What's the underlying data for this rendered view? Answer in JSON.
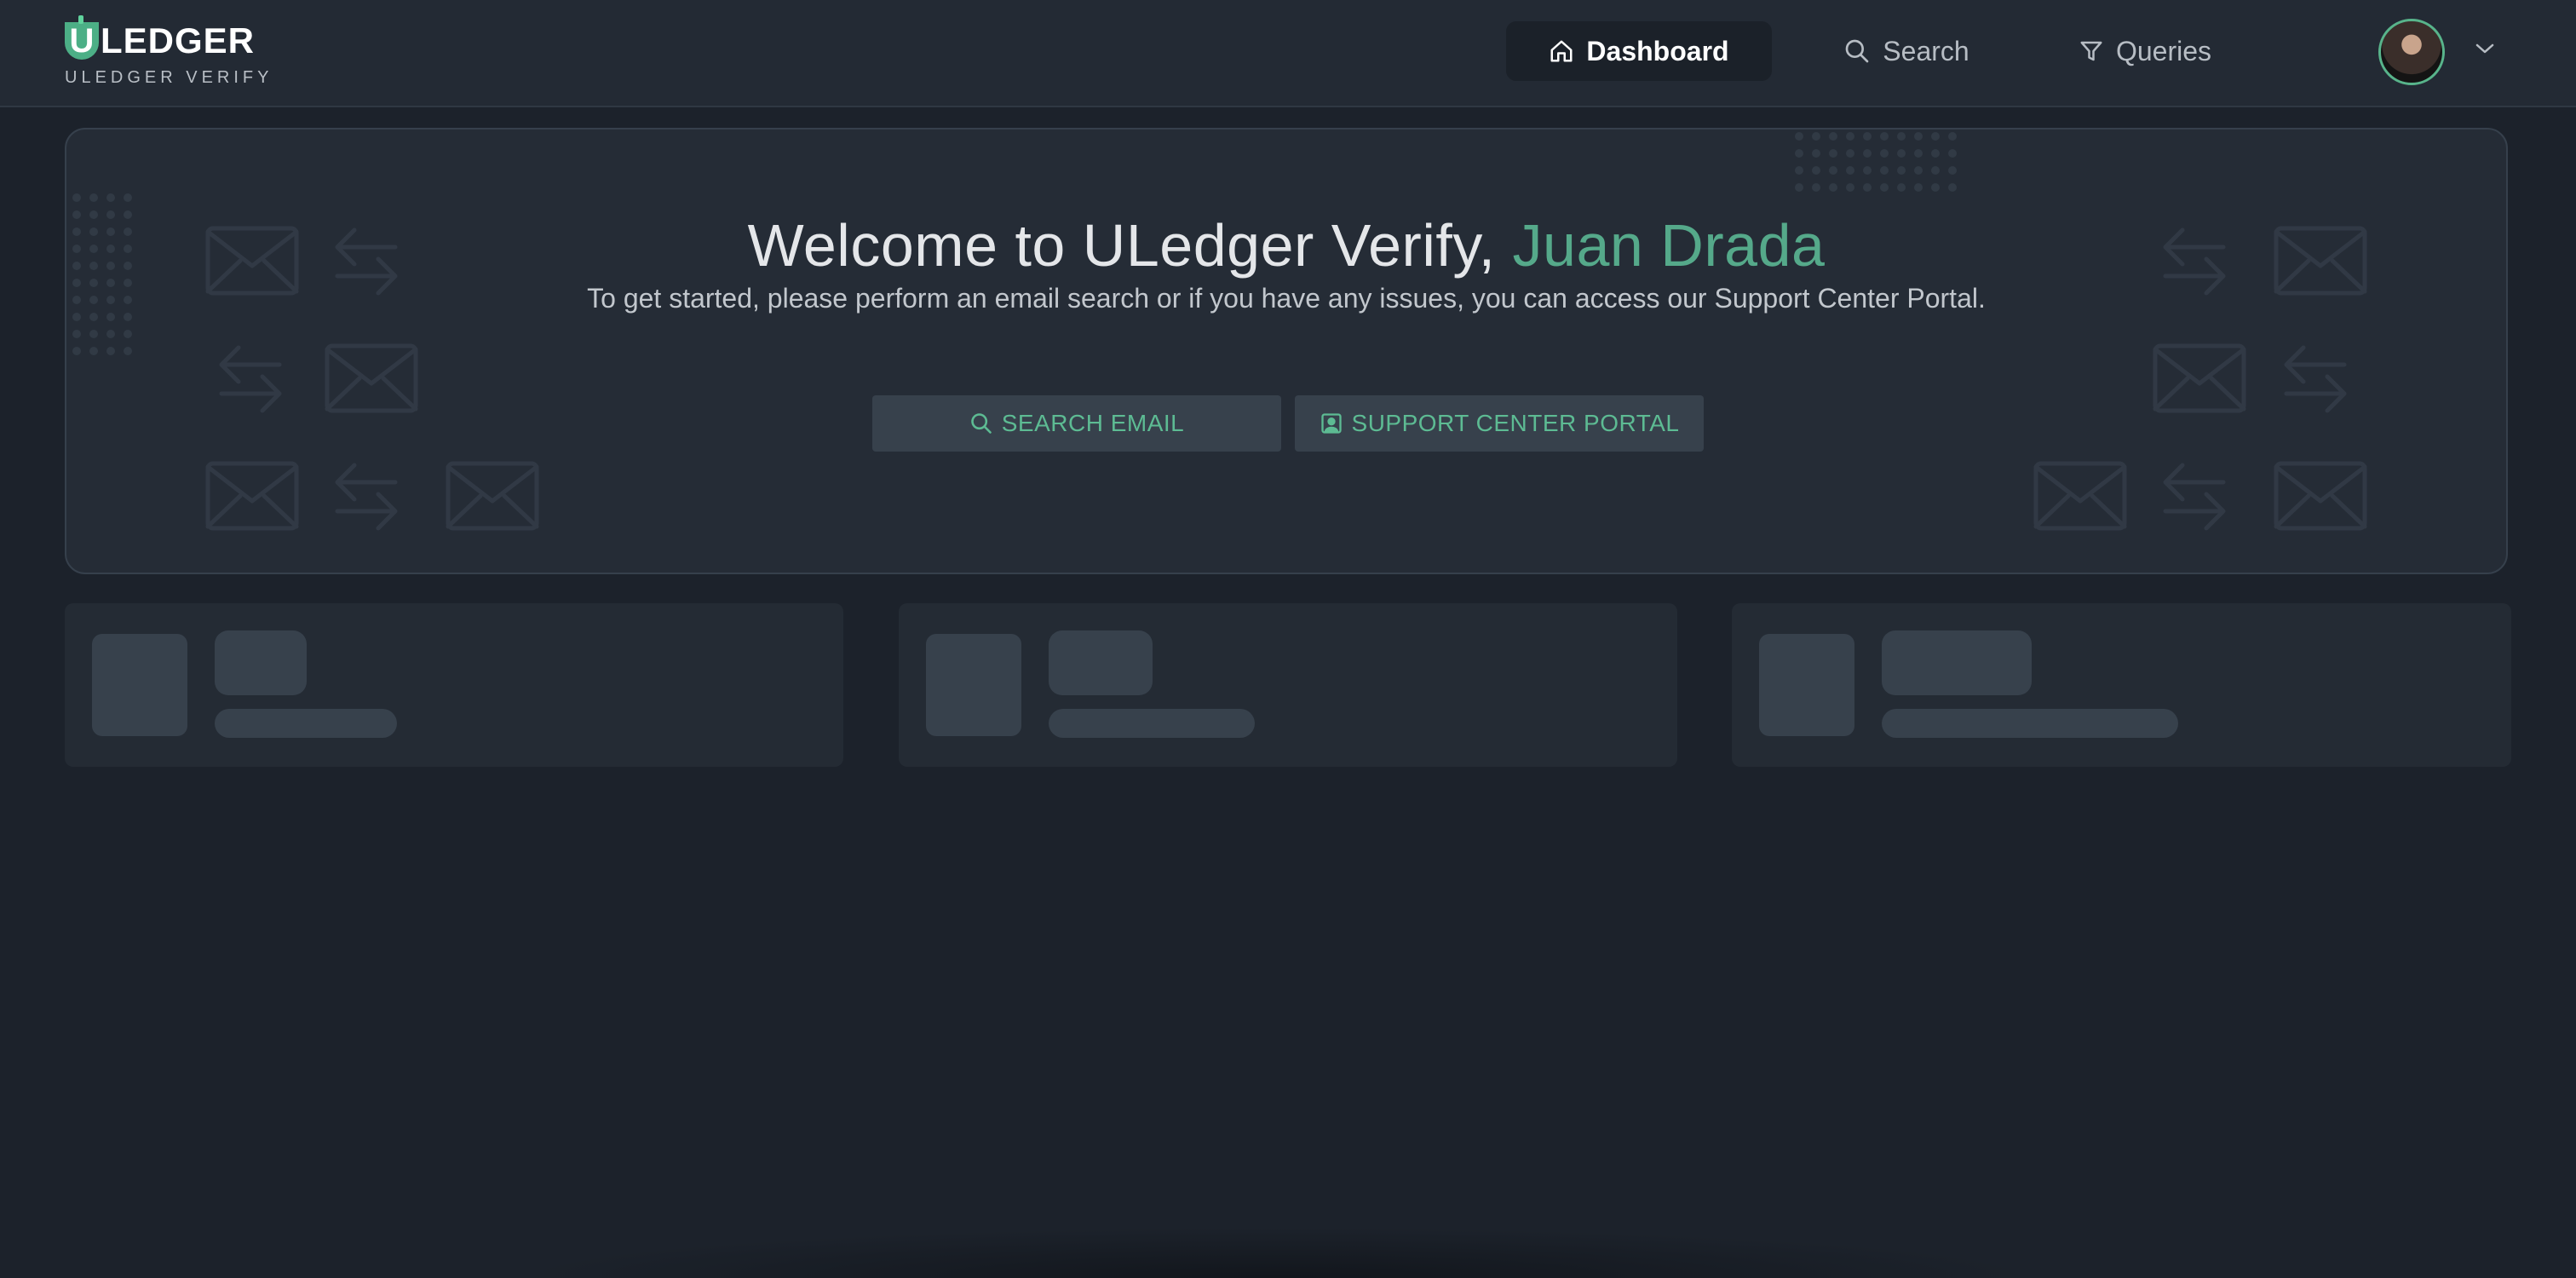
{
  "brand": {
    "logo_letter": "U",
    "logo_text": "LEDGER",
    "subtitle": "ULEDGER VERIFY",
    "accent_color": "#55a98a"
  },
  "nav": {
    "dashboard": {
      "label": "Dashboard",
      "icon": "home-icon",
      "active": true
    },
    "search": {
      "label": "Search",
      "icon": "search-icon"
    },
    "queries": {
      "label": "Queries",
      "icon": "filter-icon"
    }
  },
  "user": {
    "avatar_icon": "avatar",
    "menu_icon": "chevron-down-icon"
  },
  "hero": {
    "title_prefix": "Welcome to ULedger Verify, ",
    "user_name": "Juan Drada",
    "subtitle": "To get started, please perform an email search or if you have any issues, you can access our Support Center Portal.",
    "search_button_label": "SEARCH EMAIL",
    "search_button_icon": "search-icon",
    "support_button_label": "SUPPORT CENTER PORTAL",
    "support_button_icon": "support-icon",
    "decorations": [
      "envelope-icon",
      "arrows-exchange-icon"
    ]
  },
  "stat_cards": [
    {
      "state": "loading"
    },
    {
      "state": "loading"
    },
    {
      "state": "loading"
    }
  ]
}
